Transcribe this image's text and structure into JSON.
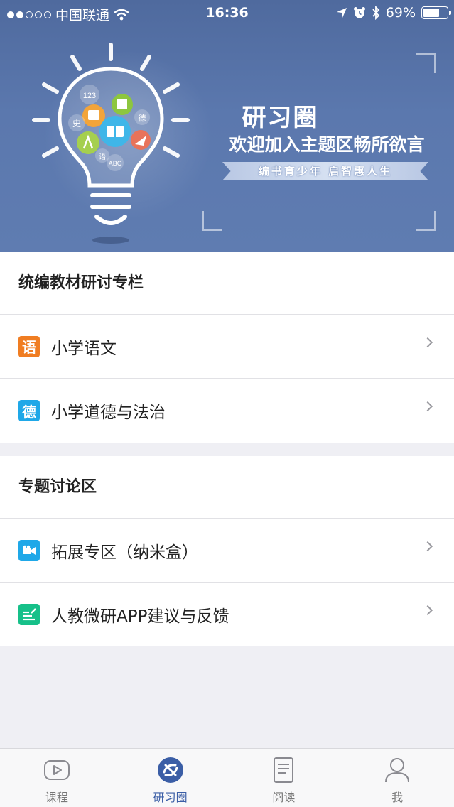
{
  "status_bar": {
    "carrier": "中国联通",
    "time": "16:36",
    "battery": "69%",
    "battery_level": 0.69
  },
  "banner": {
    "title": "研习圈",
    "subtitle": "欢迎加入主题区畅所欲言",
    "ribbon": "编书育少年 启智惠人生",
    "bulb_labels": [
      "123",
      "史",
      "德",
      "语",
      "ABC"
    ]
  },
  "sections": [
    {
      "header": "统编教材研讨专栏",
      "items": [
        {
          "label": "小学语文",
          "icon_char": "语",
          "icon": "chinese-book-icon",
          "color": "#f07d22"
        },
        {
          "label": "小学道德与法治",
          "icon_char": "德",
          "icon": "morality-icon",
          "color": "#1fa8e8"
        }
      ]
    },
    {
      "header": "专题讨论区",
      "items": [
        {
          "label": "拓展专区（纳米盒）",
          "icon": "video-camera-icon",
          "color": "#1fa8e8"
        },
        {
          "label": "人教微研APP建议与反馈",
          "icon": "feedback-edit-icon",
          "color": "#16c089"
        }
      ]
    }
  ],
  "tabbar": {
    "tabs": [
      {
        "label": "课程",
        "icon": "play-icon"
      },
      {
        "label": "研习圈",
        "icon": "circle-icon",
        "active": true
      },
      {
        "label": "阅读",
        "icon": "book-icon"
      },
      {
        "label": "我",
        "icon": "person-icon"
      }
    ],
    "active_color": "#3b5ea6"
  }
}
